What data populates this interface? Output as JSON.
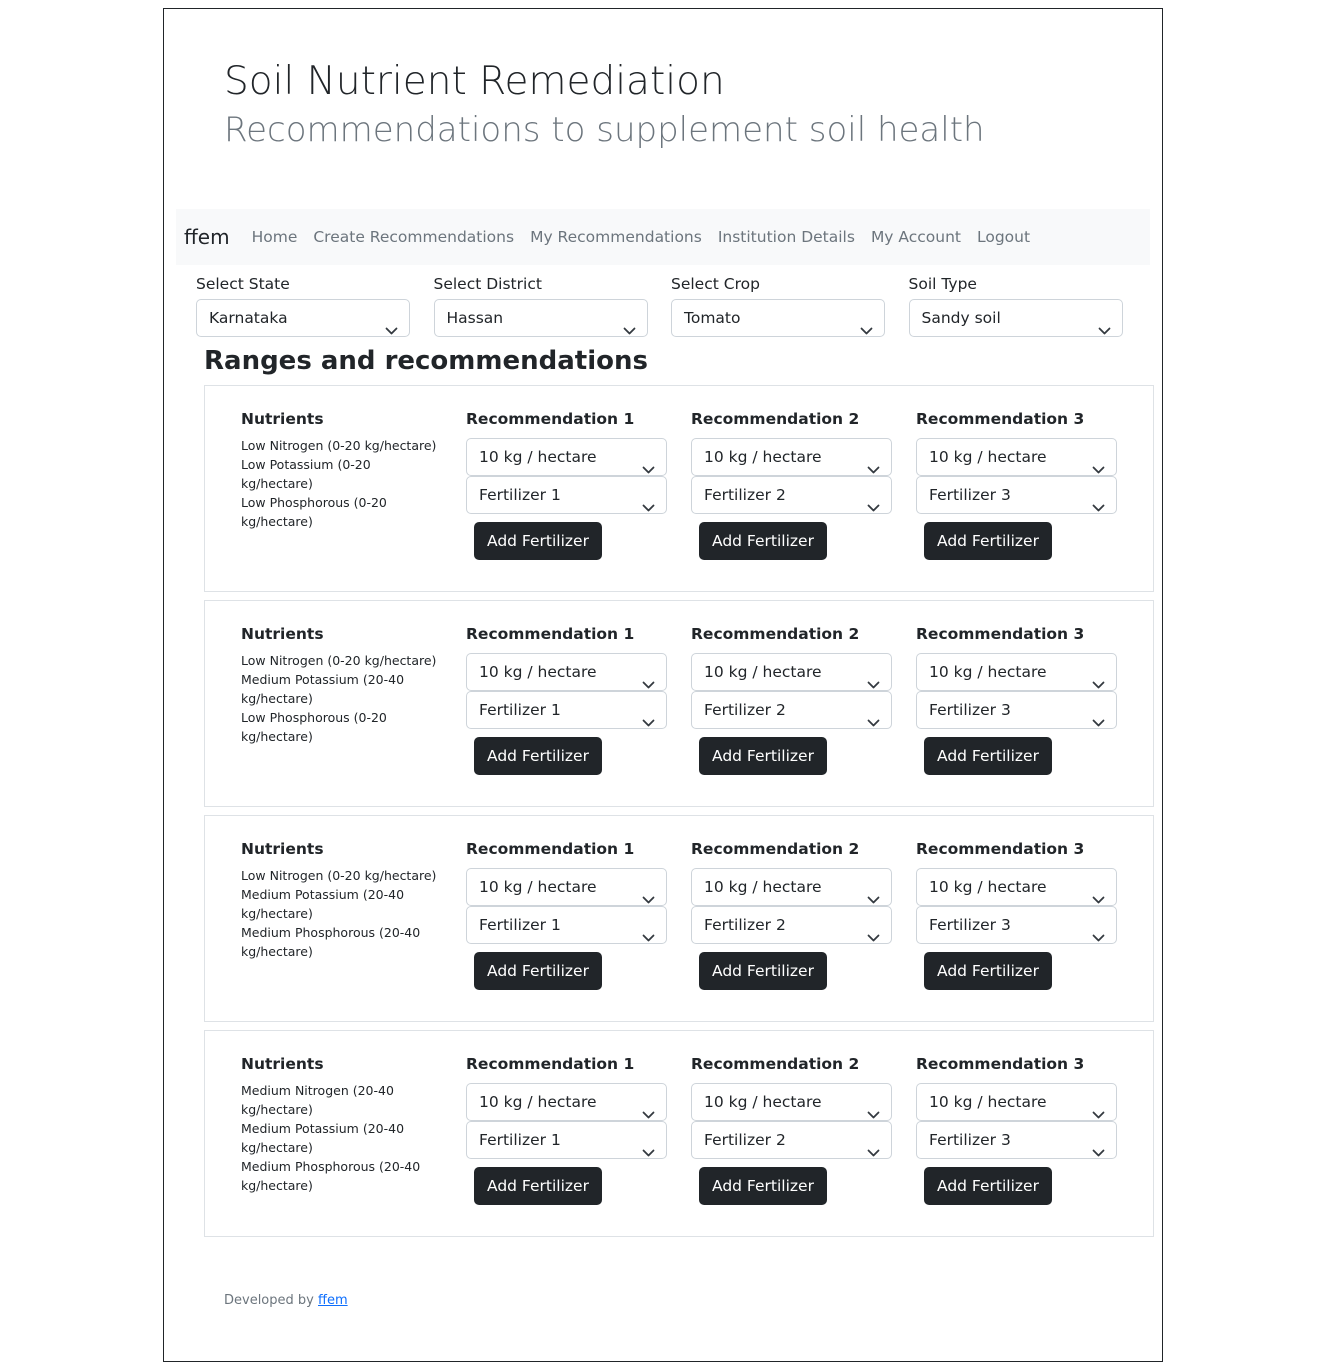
{
  "header": {
    "title": "Soil Nutrient Remediation",
    "subtitle": "Recommendations to supplement soil health"
  },
  "navbar": {
    "brand": "ffem",
    "links": [
      "Home",
      "Create Recommendations",
      "My Recommendations",
      "Institution Details",
      "My Account",
      "Logout"
    ]
  },
  "filters": [
    {
      "label": "Select State",
      "value": "Karnataka"
    },
    {
      "label": "Select District",
      "value": "Hassan"
    },
    {
      "label": "Select Crop",
      "value": "Tomato"
    },
    {
      "label": "Soil Type",
      "value": "Sandy soil"
    }
  ],
  "section_title": "Ranges and recommendations",
  "cards": [
    {
      "nutrients_heading": "Nutrients",
      "nutrients": [
        "Low Nitrogen (0-20 kg/hectare)",
        "Low Potassium (0-20 kg/hectare)",
        "Low Phosphorous (0-20 kg/hectare)"
      ],
      "recommendations": [
        {
          "heading": "Recommendation 1",
          "amount": "10 kg / hectare",
          "fertilizer": "Fertilizer 1",
          "button": "Add Fertilizer"
        },
        {
          "heading": "Recommendation 2",
          "amount": "10 kg / hectare",
          "fertilizer": "Fertilizer 2",
          "button": "Add Fertilizer"
        },
        {
          "heading": "Recommendation 3",
          "amount": "10 kg / hectare",
          "fertilizer": "Fertilizer 3",
          "button": "Add Fertilizer"
        }
      ]
    },
    {
      "nutrients_heading": "Nutrients",
      "nutrients": [
        "Low Nitrogen (0-20 kg/hectare)",
        "Medium Potassium (20-40 kg/hectare)",
        "Low Phosphorous (0-20 kg/hectare)"
      ],
      "recommendations": [
        {
          "heading": "Recommendation 1",
          "amount": "10 kg / hectare",
          "fertilizer": "Fertilizer 1",
          "button": "Add Fertilizer"
        },
        {
          "heading": "Recommendation 2",
          "amount": "10 kg / hectare",
          "fertilizer": "Fertilizer 2",
          "button": "Add Fertilizer"
        },
        {
          "heading": "Recommendation 3",
          "amount": "10 kg / hectare",
          "fertilizer": "Fertilizer 3",
          "button": "Add Fertilizer"
        }
      ]
    },
    {
      "nutrients_heading": "Nutrients",
      "nutrients": [
        "Low Nitrogen (0-20 kg/hectare)",
        "Medium Potassium (20-40 kg/hectare)",
        "Medium Phosphorous (20-40 kg/hectare)"
      ],
      "recommendations": [
        {
          "heading": "Recommendation 1",
          "amount": "10 kg / hectare",
          "fertilizer": "Fertilizer 1",
          "button": "Add Fertilizer"
        },
        {
          "heading": "Recommendation 2",
          "amount": "10 kg / hectare",
          "fertilizer": "Fertilizer 2",
          "button": "Add Fertilizer"
        },
        {
          "heading": "Recommendation 3",
          "amount": "10 kg / hectare",
          "fertilizer": "Fertilizer 3",
          "button": "Add Fertilizer"
        }
      ]
    },
    {
      "nutrients_heading": "Nutrients",
      "nutrients": [
        "Medium Nitrogen (20-40 kg/hectare)",
        "Medium Potassium (20-40 kg/hectare)",
        "Medium Phosphorous (20-40 kg/hectare)"
      ],
      "recommendations": [
        {
          "heading": "Recommendation 1",
          "amount": "10 kg / hectare",
          "fertilizer": "Fertilizer 1",
          "button": "Add Fertilizer"
        },
        {
          "heading": "Recommendation 2",
          "amount": "10 kg / hectare",
          "fertilizer": "Fertilizer 2",
          "button": "Add Fertilizer"
        },
        {
          "heading": "Recommendation 3",
          "amount": "10 kg / hectare",
          "fertilizer": "Fertilizer 3",
          "button": "Add Fertilizer"
        }
      ]
    }
  ],
  "footer": {
    "prefix": "Developed by",
    "link": "ffem"
  }
}
